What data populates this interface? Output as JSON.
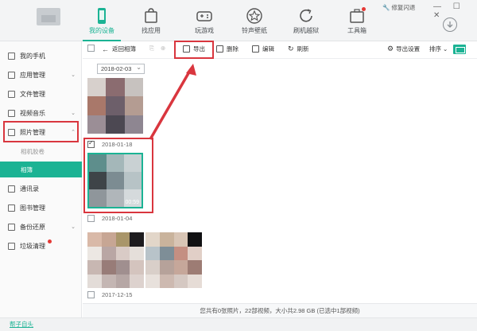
{
  "header": {
    "repair_label": "修复闪退",
    "nav": [
      {
        "label": "我的设备",
        "icon": "phone-icon",
        "active": true
      },
      {
        "label": "找应用",
        "icon": "shopping-bag-icon",
        "active": false
      },
      {
        "label": "玩游戏",
        "icon": "gamepad-icon",
        "active": false
      },
      {
        "label": "铃声壁纸",
        "icon": "star-icon",
        "active": false
      },
      {
        "label": "刷机越狱",
        "icon": "refresh-icon",
        "active": false
      },
      {
        "label": "工具箱",
        "icon": "toolbox-icon",
        "active": false
      }
    ]
  },
  "sidebar": {
    "items": [
      {
        "label": "我的手机",
        "icon": "phone-icon"
      },
      {
        "label": "应用管理",
        "icon": "apps-icon"
      },
      {
        "label": "文件管理",
        "icon": "folder-icon"
      },
      {
        "label": "视频音乐",
        "icon": "video-icon"
      },
      {
        "label": "照片管理",
        "icon": "photo-icon"
      },
      {
        "label": "相机胶卷",
        "icon": ""
      },
      {
        "label": "相簿",
        "icon": ""
      },
      {
        "label": "通讯录",
        "icon": "contacts-icon"
      },
      {
        "label": "图书管理",
        "icon": "book-icon"
      },
      {
        "label": "备份还原",
        "icon": "backup-icon"
      },
      {
        "label": "垃圾清理",
        "icon": "trash-icon"
      }
    ],
    "footer_link": "帮子自头"
  },
  "toolbar": {
    "back_label": "返回相簿",
    "export_label": "导出",
    "delete_label": "删除",
    "edit_label": "编辑",
    "refresh_label": "刷新",
    "export_settings_label": "导出设置",
    "sort_label": "排序"
  },
  "content": {
    "date_filter": "2018-02-03",
    "groups": [
      {
        "date": "2018-01-18"
      },
      {
        "date": "2018-01-04"
      },
      {
        "date": "2017-12-15"
      }
    ],
    "video_duration": "00:59"
  },
  "status": {
    "summary": "您共有0张照片，22部视频，大小共2.98 GB (已选中1部视频)"
  },
  "colors": {
    "accent": "#1bb394",
    "annotation": "#d9363e"
  }
}
